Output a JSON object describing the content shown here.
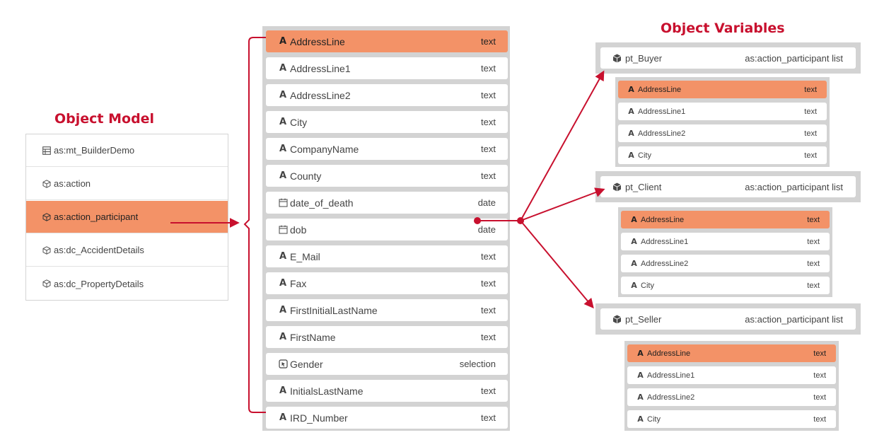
{
  "object_model": {
    "title": "Object Model",
    "items": [
      {
        "label": "as:mt_BuilderDemo",
        "icon": "table-icon"
      },
      {
        "label": "as:action",
        "icon": "cube-outline-icon"
      },
      {
        "label": "as:action_participant",
        "icon": "cube-outline-icon",
        "selected": true
      },
      {
        "label": "as:dc_AccidentDetails",
        "icon": "cube-outline-icon"
      },
      {
        "label": "as:dc_PropertyDetails",
        "icon": "cube-outline-icon"
      }
    ]
  },
  "fields": [
    {
      "name": "AddressLine",
      "type": "text",
      "icon": "text-icon",
      "selected": true
    },
    {
      "name": "AddressLine1",
      "type": "text",
      "icon": "text-icon"
    },
    {
      "name": "AddressLine2",
      "type": "text",
      "icon": "text-icon"
    },
    {
      "name": "City",
      "type": "text",
      "icon": "text-icon"
    },
    {
      "name": "CompanyName",
      "type": "text",
      "icon": "text-icon"
    },
    {
      "name": "County",
      "type": "text",
      "icon": "text-icon"
    },
    {
      "name": "date_of_death",
      "type": "date",
      "icon": "calendar-icon"
    },
    {
      "name": "dob",
      "type": "date",
      "icon": "calendar-icon"
    },
    {
      "name": "E_Mail",
      "type": "text",
      "icon": "text-icon"
    },
    {
      "name": "Fax",
      "type": "text",
      "icon": "text-icon"
    },
    {
      "name": "FirstInitialLastName",
      "type": "text",
      "icon": "text-icon"
    },
    {
      "name": "FirstName",
      "type": "text",
      "icon": "text-icon"
    },
    {
      "name": "Gender",
      "type": "selection",
      "icon": "selection-icon"
    },
    {
      "name": "InitialsLastName",
      "type": "text",
      "icon": "text-icon"
    },
    {
      "name": "IRD_Number",
      "type": "text",
      "icon": "text-icon"
    }
  ],
  "object_variables": {
    "title": "Object Variables",
    "items": [
      {
        "name": "pt_Buyer",
        "type": "as:action_participant list",
        "icon": "cube-icon",
        "fields": [
          {
            "name": "AddressLine",
            "type": "text",
            "selected": true
          },
          {
            "name": "AddressLine1",
            "type": "text"
          },
          {
            "name": "AddressLine2",
            "type": "text"
          },
          {
            "name": "City",
            "type": "text"
          }
        ]
      },
      {
        "name": "pt_Client",
        "type": "as:action_participant list",
        "icon": "cube-icon",
        "fields": [
          {
            "name": "AddressLine",
            "type": "text",
            "selected": true
          },
          {
            "name": "AddressLine1",
            "type": "text"
          },
          {
            "name": "AddressLine2",
            "type": "text"
          },
          {
            "name": "City",
            "type": "text"
          }
        ]
      },
      {
        "name": "pt_Seller",
        "type": "as:action_participant list",
        "icon": "cube-icon",
        "fields": [
          {
            "name": "AddressLine",
            "type": "text",
            "selected": true
          },
          {
            "name": "AddressLine1",
            "type": "text"
          },
          {
            "name": "AddressLine2",
            "type": "text"
          },
          {
            "name": "City",
            "type": "text"
          }
        ]
      }
    ]
  },
  "colors": {
    "accent": "#c8102e",
    "selected": "#f39267",
    "panel": "#d3d3d3"
  }
}
